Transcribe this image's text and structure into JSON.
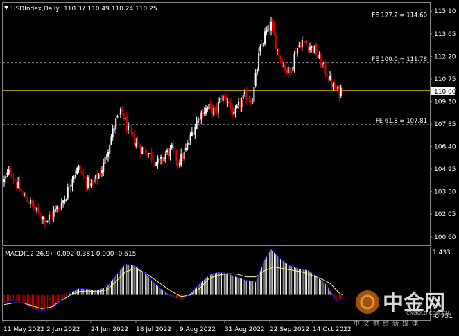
{
  "header": {
    "symbol_label": "USDIndex,Daily",
    "ohlc_label": "110.37 110.49 110.24 110.25",
    "collapse_icon": "triangle-down-icon"
  },
  "price_panel": {
    "yticks": [
      "115.10",
      "113.65",
      "112.20",
      "110.75",
      "110.00",
      "109.30",
      "107.85",
      "106.40",
      "104.95",
      "103.50",
      "102.05",
      "100.60"
    ],
    "yrange": [
      100.1,
      115.6
    ],
    "current_price_label": "110.00",
    "fib_levels": [
      {
        "label": "FE 127.2 = 114.60",
        "value": 114.6
      },
      {
        "label": "FE 100.0 = 111.78",
        "value": 111.78
      },
      {
        "label": "FE 61.8 = 107.81",
        "value": 107.81
      }
    ],
    "horizontal_line": 110.0
  },
  "macd_panel": {
    "label": "MACD(12,26,9) -0.092 0.381 0.000 -0.615",
    "top_tick": "1.433",
    "bottom_tick": "-0.751",
    "yrange": [
      -0.751,
      1.433
    ]
  },
  "x_axis": {
    "date_labels": [
      "11 May 2022",
      "2 Jun 2022",
      "24 Jun 2022",
      "18 Jul 2022",
      "9 Aug 2022",
      "31 Aug 2022",
      "22 Sep 2022",
      "14 Oct 2022"
    ]
  },
  "watermark": {
    "brand": "中金网",
    "site": "CNGOLD.COM.CN",
    "slogan": "中文财经新媒体"
  },
  "colors": {
    "bull": "#ffffff",
    "bear": "#dd0000",
    "yellow": "#e6c200",
    "signal": "#ffff66",
    "macd_line": "#1010e0",
    "grid": "#bbbbbb",
    "background": "#000000"
  },
  "chart_data": {
    "type": "candlestick",
    "price_anchors": [
      [
        0,
        104.2
      ],
      [
        4,
        104.9
      ],
      [
        8,
        104.0
      ],
      [
        12,
        103.3
      ],
      [
        16,
        102.9
      ],
      [
        20,
        102.3
      ],
      [
        24,
        101.9
      ],
      [
        28,
        101.7
      ],
      [
        32,
        102.2
      ],
      [
        36,
        102.6
      ],
      [
        40,
        103.3
      ],
      [
        44,
        104.5
      ],
      [
        48,
        105.0
      ],
      [
        52,
        104.3
      ],
      [
        56,
        103.9
      ],
      [
        60,
        104.4
      ],
      [
        64,
        105.2
      ],
      [
        68,
        106.7
      ],
      [
        72,
        108.0
      ],
      [
        76,
        108.6
      ],
      [
        80,
        107.4
      ],
      [
        84,
        106.8
      ],
      [
        88,
        106.3
      ],
      [
        92,
        106.1
      ],
      [
        96,
        105.6
      ],
      [
        100,
        105.3
      ],
      [
        104,
        105.9
      ],
      [
        108,
        106.2
      ],
      [
        112,
        105.4
      ],
      [
        116,
        105.9
      ],
      [
        120,
        107.0
      ],
      [
        124,
        108.0
      ],
      [
        128,
        108.7
      ],
      [
        132,
        108.9
      ],
      [
        136,
        108.6
      ],
      [
        140,
        109.6
      ],
      [
        144,
        109.4
      ],
      [
        148,
        108.3
      ],
      [
        152,
        109.2
      ],
      [
        156,
        109.7
      ],
      [
        160,
        109.4
      ],
      [
        164,
        112.2
      ],
      [
        168,
        113.6
      ],
      [
        172,
        114.2
      ],
      [
        176,
        112.6
      ],
      [
        180,
        111.6
      ],
      [
        184,
        111.1
      ],
      [
        188,
        112.6
      ],
      [
        192,
        113.2
      ],
      [
        196,
        112.9
      ],
      [
        200,
        112.6
      ],
      [
        204,
        111.8
      ],
      [
        208,
        111.1
      ],
      [
        212,
        110.2
      ],
      [
        216,
        109.9
      ],
      [
        218,
        110.25
      ]
    ],
    "macd_signal_anchors": [
      [
        0,
        -0.3
      ],
      [
        6,
        -0.25
      ],
      [
        12,
        -0.25
      ],
      [
        18,
        -0.33
      ],
      [
        24,
        -0.42
      ],
      [
        30,
        -0.38
      ],
      [
        36,
        -0.2
      ],
      [
        42,
        -0.02
      ],
      [
        48,
        0.1
      ],
      [
        54,
        0.12
      ],
      [
        60,
        0.1
      ],
      [
        66,
        0.15
      ],
      [
        72,
        0.4
      ],
      [
        78,
        0.7
      ],
      [
        84,
        0.8
      ],
      [
        90,
        0.7
      ],
      [
        96,
        0.5
      ],
      [
        102,
        0.3
      ],
      [
        108,
        0.1
      ],
      [
        114,
        -0.05
      ],
      [
        120,
        0.0
      ],
      [
        126,
        0.2
      ],
      [
        132,
        0.5
      ],
      [
        138,
        0.6
      ],
      [
        144,
        0.65
      ],
      [
        150,
        0.63
      ],
      [
        156,
        0.55
      ],
      [
        162,
        0.55
      ],
      [
        168,
        0.75
      ],
      [
        174,
        0.85
      ],
      [
        180,
        0.8
      ],
      [
        186,
        0.75
      ],
      [
        192,
        0.7
      ],
      [
        198,
        0.6
      ],
      [
        204,
        0.5
      ],
      [
        210,
        0.35
      ],
      [
        216,
        0.05
      ],
      [
        218,
        0.0
      ]
    ],
    "macd_line_anchors": [
      [
        0,
        -0.25
      ],
      [
        6,
        -0.15
      ],
      [
        12,
        -0.25
      ],
      [
        18,
        -0.4
      ],
      [
        24,
        -0.5
      ],
      [
        30,
        -0.45
      ],
      [
        36,
        -0.2
      ],
      [
        42,
        0.05
      ],
      [
        48,
        0.2
      ],
      [
        54,
        0.18
      ],
      [
        60,
        0.15
      ],
      [
        66,
        0.25
      ],
      [
        72,
        0.6
      ],
      [
        78,
        0.95
      ],
      [
        84,
        0.9
      ],
      [
        90,
        0.7
      ],
      [
        96,
        0.4
      ],
      [
        102,
        0.15
      ],
      [
        108,
        -0.05
      ],
      [
        114,
        -0.15
      ],
      [
        120,
        0.05
      ],
      [
        126,
        0.35
      ],
      [
        132,
        0.6
      ],
      [
        138,
        0.7
      ],
      [
        144,
        0.65
      ],
      [
        150,
        0.55
      ],
      [
        156,
        0.45
      ],
      [
        162,
        0.4
      ],
      [
        168,
        1.1
      ],
      [
        172,
        1.4
      ],
      [
        178,
        1.1
      ],
      [
        184,
        0.9
      ],
      [
        190,
        0.8
      ],
      [
        196,
        0.75
      ],
      [
        202,
        0.55
      ],
      [
        208,
        0.3
      ],
      [
        214,
        -0.2
      ],
      [
        218,
        -0.09
      ]
    ]
  }
}
